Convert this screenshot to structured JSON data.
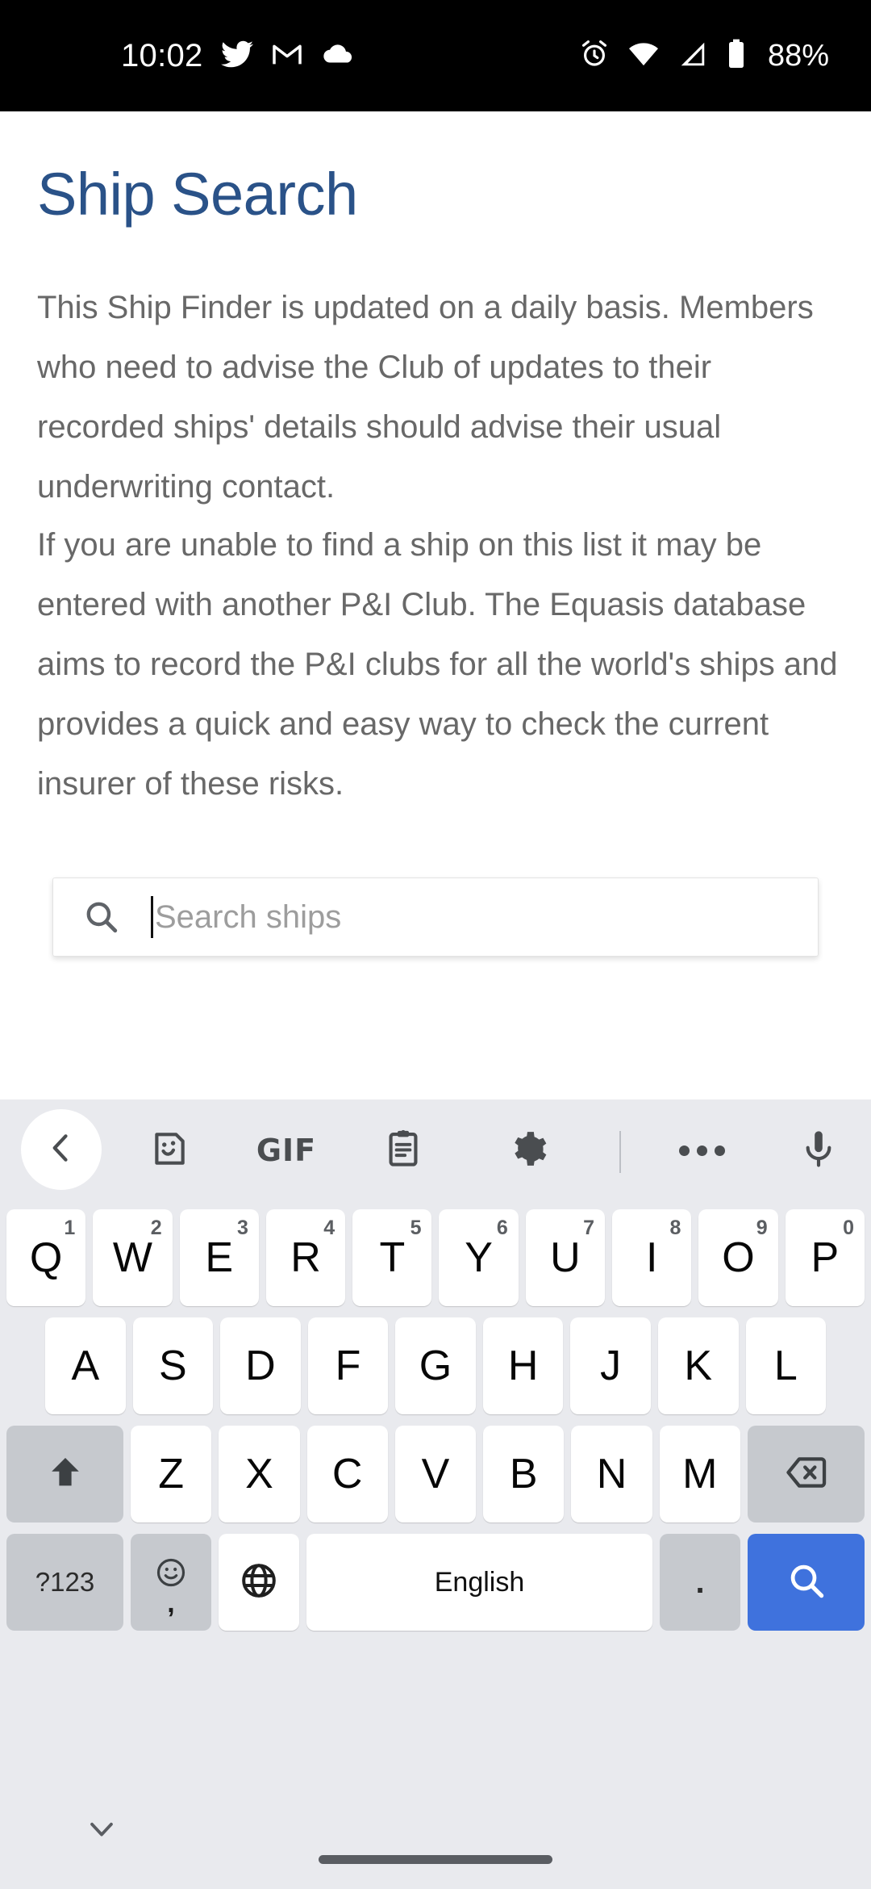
{
  "status_bar": {
    "time": "10:02",
    "battery_percent": "88%",
    "left_icons": [
      "twitter-icon",
      "gmail-icon",
      "cloud-icon"
    ],
    "right_icons": [
      "alarm-icon",
      "wifi-icon",
      "cellular-signal-icon",
      "battery-icon"
    ]
  },
  "page": {
    "title": "Ship Search",
    "title_color": "#2a5288",
    "paragraphs": [
      "This Ship Finder is updated on a daily basis. Members who need to advise the Club of updates to their recorded ships' details should advise their usual underwriting contact.",
      "If you are unable to find a ship on this list it may be entered with another P&I Club. The Equasis database aims to record the P&I clubs for all the world's ships and provides a quick and easy way to check the current insurer of these risks."
    ]
  },
  "search": {
    "placeholder": "Search ships",
    "value": "",
    "icon": "search-icon"
  },
  "keyboard": {
    "toolbar": {
      "back_icon": "chevron-left-icon",
      "items": [
        "sticker-icon",
        "gif-icon",
        "clipboard-icon",
        "settings-gear-icon",
        "more-icon",
        "microphone-icon"
      ],
      "gif_label": "GIF"
    },
    "row1": [
      {
        "letter": "Q",
        "num": "1"
      },
      {
        "letter": "W",
        "num": "2"
      },
      {
        "letter": "E",
        "num": "3"
      },
      {
        "letter": "R",
        "num": "4"
      },
      {
        "letter": "T",
        "num": "5"
      },
      {
        "letter": "Y",
        "num": "6"
      },
      {
        "letter": "U",
        "num": "7"
      },
      {
        "letter": "I",
        "num": "8"
      },
      {
        "letter": "O",
        "num": "9"
      },
      {
        "letter": "P",
        "num": "0"
      }
    ],
    "row2": [
      {
        "letter": "A"
      },
      {
        "letter": "S"
      },
      {
        "letter": "D"
      },
      {
        "letter": "F"
      },
      {
        "letter": "G"
      },
      {
        "letter": "H"
      },
      {
        "letter": "J"
      },
      {
        "letter": "K"
      },
      {
        "letter": "L"
      }
    ],
    "row3": [
      {
        "letter": "Z"
      },
      {
        "letter": "X"
      },
      {
        "letter": "C"
      },
      {
        "letter": "V"
      },
      {
        "letter": "B"
      },
      {
        "letter": "N"
      },
      {
        "letter": "M"
      }
    ],
    "shift_icon": "shift-arrow-icon",
    "backspace_icon": "backspace-icon",
    "row4": {
      "symbols_label": "?123",
      "emoji_icon": "emoji-smiley-icon",
      "comma_label": ",",
      "globe_icon": "language-globe-icon",
      "space_label": "English",
      "period_label": ".",
      "search_icon": "search-icon",
      "accent_color": "#3f72dd"
    }
  },
  "nav_bar": {
    "hide_keyboard_icon": "chevron-down-icon",
    "home_indicator": "home-gesture-pill"
  }
}
